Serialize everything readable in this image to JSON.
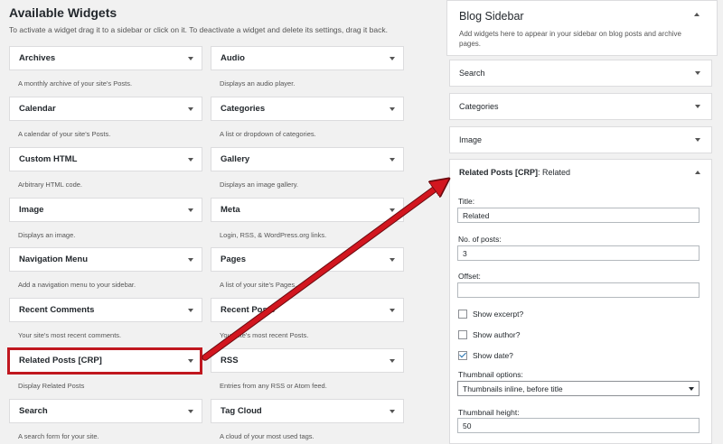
{
  "available": {
    "title": "Available Widgets",
    "description": "To activate a widget drag it to a sidebar or click on it. To deactivate a widget and delete its settings, drag it back.",
    "widgets": [
      {
        "name": "Archives",
        "desc": "A monthly archive of your site's Posts."
      },
      {
        "name": "Audio",
        "desc": "Displays an audio player."
      },
      {
        "name": "Calendar",
        "desc": "A calendar of your site's Posts."
      },
      {
        "name": "Categories",
        "desc": "A list or dropdown of categories."
      },
      {
        "name": "Custom HTML",
        "desc": "Arbitrary HTML code."
      },
      {
        "name": "Gallery",
        "desc": "Displays an image gallery."
      },
      {
        "name": "Image",
        "desc": "Displays an image."
      },
      {
        "name": "Meta",
        "desc": "Login, RSS, & WordPress.org links."
      },
      {
        "name": "Navigation Menu",
        "desc": "Add a navigation menu to your sidebar."
      },
      {
        "name": "Pages",
        "desc": "A list of your site's Pages."
      },
      {
        "name": "Recent Comments",
        "desc": "Your site's most recent comments."
      },
      {
        "name": "Recent Posts",
        "desc": "Your site's most recent Posts."
      },
      {
        "name": "Related Posts [CRP]",
        "desc": "Display Related Posts"
      },
      {
        "name": "RSS",
        "desc": "Entries from any RSS or Atom feed."
      },
      {
        "name": "Search",
        "desc": "A search form for your site."
      },
      {
        "name": "Tag Cloud",
        "desc": "A cloud of your most used tags."
      }
    ]
  },
  "sidebar": {
    "title": "Blog Sidebar",
    "description": "Add widgets here to appear in your sidebar on blog posts and archive pages.",
    "widgets": [
      {
        "name": "Search"
      },
      {
        "name": "Categories"
      },
      {
        "name": "Image"
      }
    ],
    "open_widget": {
      "name": "Related Posts [CRP]",
      "suffix": ": Related",
      "fields": {
        "title_label": "Title:",
        "title_value": "Related",
        "count_label": "No. of posts:",
        "count_value": "3",
        "offset_label": "Offset:",
        "offset_value": "",
        "show_excerpt_label": "Show excerpt?",
        "show_excerpt": false,
        "show_author_label": "Show author?",
        "show_author": false,
        "show_date_label": "Show date?",
        "show_date": true,
        "thumb_options_label": "Thumbnail options:",
        "thumb_options_value": "Thumbnails inline, before title",
        "thumb_height_label": "Thumbnail height:",
        "thumb_height_value": "50"
      }
    }
  },
  "colors": {
    "highlight": "#c0171f",
    "checkbox_tick": "#2271b1"
  },
  "icons": {
    "widget_toggle": "caret-down-icon",
    "open_toggle": "caret-up-icon",
    "select_arrow": "dropdown-arrow-icon"
  }
}
